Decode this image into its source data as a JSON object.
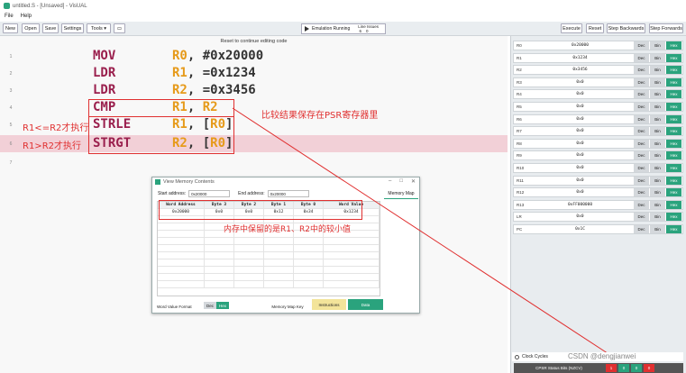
{
  "window": {
    "title": "untitled.S - [Unsaved] - VisUAL"
  },
  "menu": [
    "File",
    "Help"
  ],
  "toolbar": {
    "new": "New",
    "open": "Open",
    "save": "Save",
    "settings": "Settings",
    "tools": "Tools ▾",
    "emulation_status": "Emulation Running",
    "line_label": "Line",
    "issues_label": "Issues",
    "line_value": "6",
    "issues_value": "0",
    "execute": "Execute",
    "reset": "Reset",
    "step_backwards": "Step Backwards",
    "step_forwards": "Step Forwards"
  },
  "editor": {
    "reset_note": "Reset to continue editing code",
    "lines": [
      {
        "num": "1",
        "op": "MOV",
        "r": "R0",
        "rest": ", #0x20000"
      },
      {
        "num": "2",
        "op": "LDR",
        "r": "R1",
        "rest": ", =0x1234"
      },
      {
        "num": "3",
        "op": "LDR",
        "r": "R2",
        "rest": ", =0x3456"
      },
      {
        "num": "4",
        "op": "CMP",
        "r": "R1",
        "rest": ", ",
        "r2": "R2"
      },
      {
        "num": "5",
        "op": "STRLE",
        "r": "R1",
        "rest": ", [",
        "r2": "R0",
        "tail": "]"
      },
      {
        "num": "6",
        "op": "STRGT",
        "r": "R2",
        "rest": ", [",
        "r2": "R0",
        "tail": "]"
      },
      {
        "num": "7",
        "op": "",
        "r": "",
        "rest": ""
      }
    ]
  },
  "annotations": {
    "cmp_note": "比较结果保存在PSR寄存器里",
    "le_note": "R1<=R2才执行",
    "gt_note": "R1>R2才执行",
    "mem_note": "内存中保留的是R1、R2中的较小值"
  },
  "memory_window": {
    "title": "View Memory Contents",
    "start_label": "Start address:",
    "start_value": "0x20000",
    "end_label": "End address:",
    "end_value": "0x20000",
    "tab": "Memory Map",
    "headers": [
      "Word Address",
      "Byte 3",
      "Byte 2",
      "Byte 1",
      "Byte 0",
      "Word Value"
    ],
    "rows": [
      [
        "0x20000",
        "0x0",
        "0x0",
        "0x12",
        "0x34",
        "0x1234"
      ]
    ],
    "format_label": "Word Value Format",
    "dec": "Dec",
    "hex": "Hex",
    "key_label": "Memory Map Key",
    "instructions": "Instructions",
    "data": "Data"
  },
  "registers": [
    {
      "name": "R0",
      "value": "0x20000"
    },
    {
      "name": "R1",
      "value": "0x1234"
    },
    {
      "name": "R2",
      "value": "0x3456"
    },
    {
      "name": "R3",
      "value": "0x0"
    },
    {
      "name": "R4",
      "value": "0x0"
    },
    {
      "name": "R5",
      "value": "0x0"
    },
    {
      "name": "R6",
      "value": "0x0"
    },
    {
      "name": "R7",
      "value": "0x0"
    },
    {
      "name": "R8",
      "value": "0x0"
    },
    {
      "name": "R9",
      "value": "0x0"
    },
    {
      "name": "R10",
      "value": "0x0"
    },
    {
      "name": "R11",
      "value": "0x0"
    },
    {
      "name": "R12",
      "value": "0x0"
    },
    {
      "name": "R13",
      "value": "0xFF000000"
    },
    {
      "name": "LR",
      "value": "0x0"
    },
    {
      "name": "PC",
      "value": "0x1C"
    }
  ],
  "reg_buttons": {
    "dec": "Dec",
    "bin": "Bin",
    "hex": "Hex"
  },
  "footer": {
    "clock_cycles": "Clock Cycles",
    "cpsr_label": "CPSR Status Bits (NZCV)",
    "flags": [
      "1",
      "0",
      "0",
      "0"
    ],
    "watermark": "CSDN @dengjianwei"
  },
  "colors": {
    "accent": "#2aa37d",
    "annotation": "#e03030",
    "opcode": "#9a1f4d",
    "register": "#e69a1a"
  }
}
